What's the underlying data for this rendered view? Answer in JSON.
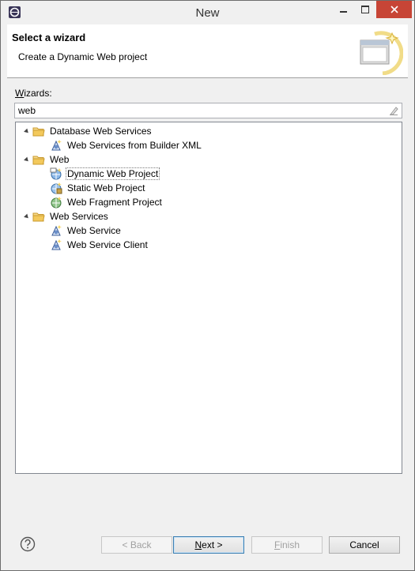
{
  "window": {
    "title": "New"
  },
  "banner": {
    "title": "Select a wizard",
    "description": "Create a Dynamic Web project"
  },
  "wizards": {
    "label_prefix": "W",
    "label_rest": "izards:",
    "filter_value": "web"
  },
  "tree": [
    {
      "label": "Database Web Services",
      "type": "folder",
      "expanded": true
    },
    {
      "label": "Web Services from Builder XML",
      "type": "wizard-ws"
    },
    {
      "label": "Web",
      "type": "folder",
      "expanded": true
    },
    {
      "label": "Dynamic Web Project",
      "type": "wizard-dynamic",
      "selected": true
    },
    {
      "label": "Static Web Project",
      "type": "wizard-static"
    },
    {
      "label": "Web Fragment Project",
      "type": "wizard-fragment"
    },
    {
      "label": "Web Services",
      "type": "folder",
      "expanded": true
    },
    {
      "label": "Web Service",
      "type": "wizard-ws"
    },
    {
      "label": "Web Service Client",
      "type": "wizard-ws"
    }
  ],
  "buttons": {
    "back": "< Back",
    "next_mnemonic": "N",
    "next_rest": "ext >",
    "finish_mnemonic": "F",
    "finish_rest": "inish",
    "cancel": "Cancel"
  },
  "colors": {
    "close_button": "#c74536",
    "folder": "#e8b84a",
    "selection_border": "#7a7a7a"
  }
}
